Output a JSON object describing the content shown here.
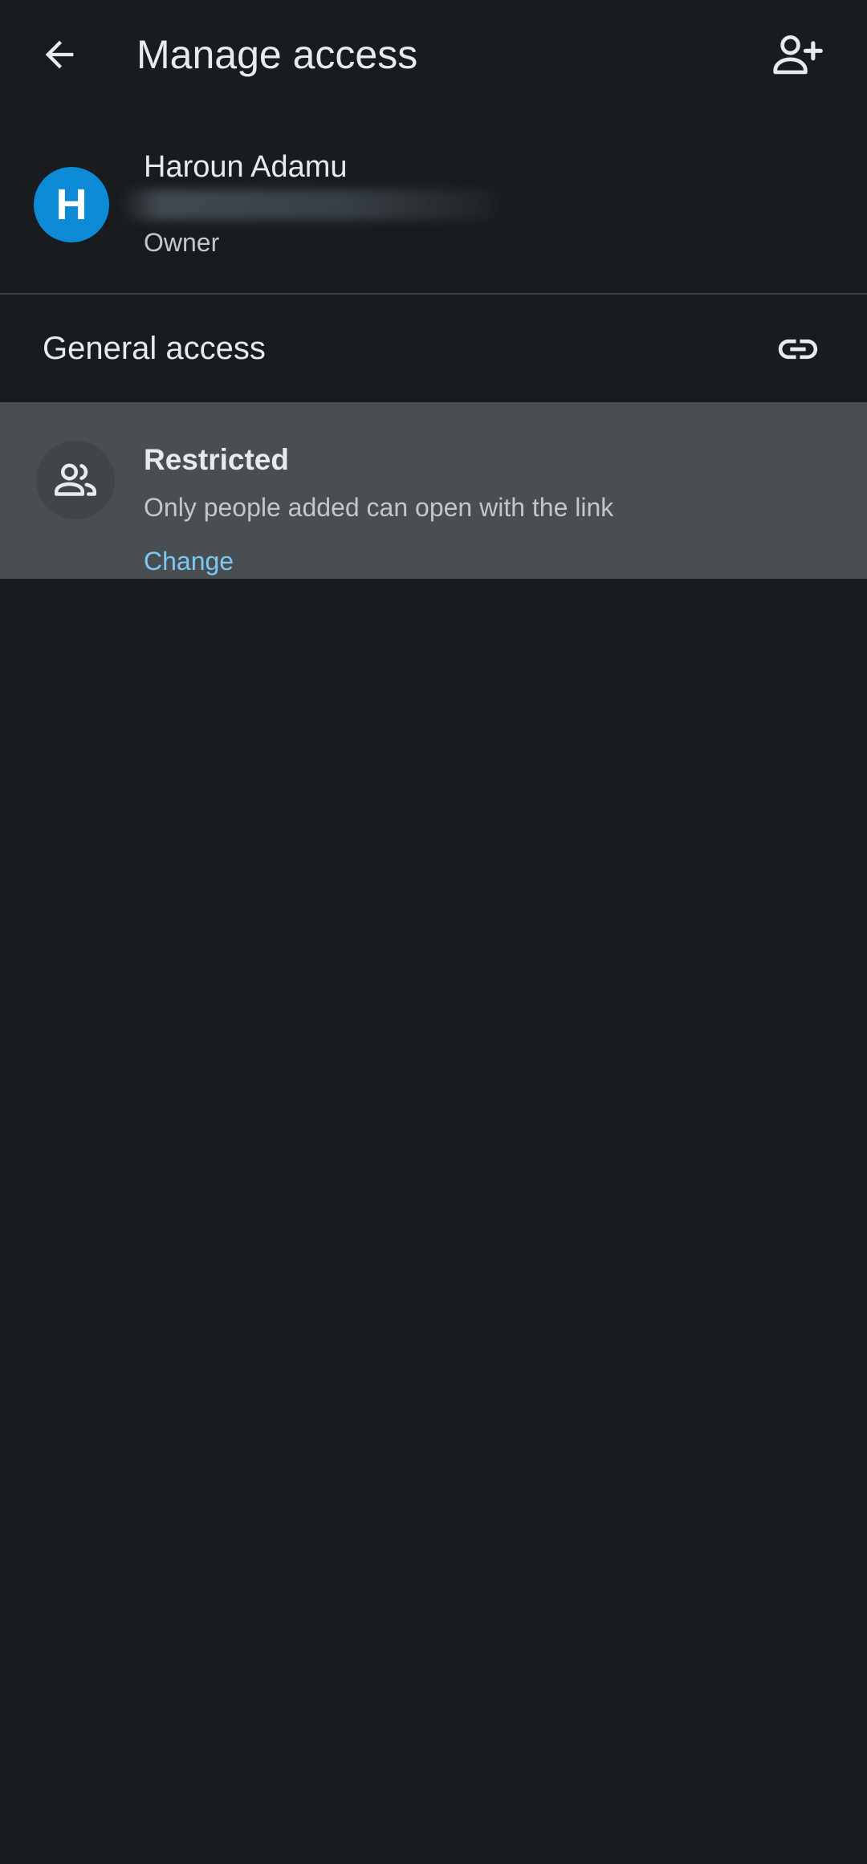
{
  "appbar": {
    "title": "Manage access",
    "back_icon": "arrow-left-icon",
    "add_person_icon": "person-add-icon"
  },
  "owner": {
    "avatar_letter": "H",
    "avatar_color": "#0c8ad6",
    "name": "Haroun Adamu",
    "role": "Owner"
  },
  "general_access": {
    "title": "General access",
    "link_icon": "link-icon",
    "setting": {
      "icon": "people-icon",
      "label": "Restricted",
      "description": "Only people added can open with the link",
      "action_label": "Change"
    }
  },
  "colors": {
    "background": "#181c1f",
    "selected_row": "#494e52",
    "accent_link": "#7cc8f2"
  }
}
